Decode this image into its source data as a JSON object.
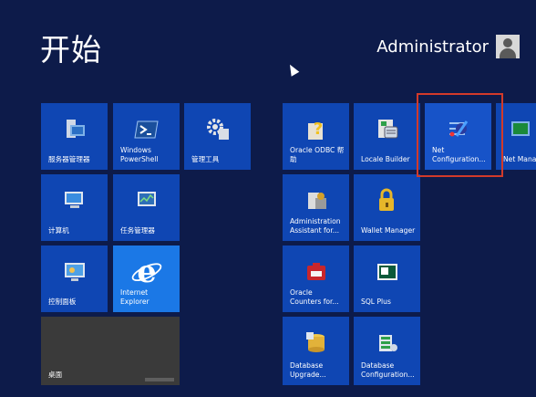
{
  "screen": {
    "title": "开始"
  },
  "user": {
    "name": "Administrator"
  },
  "tiles_left": [
    {
      "label": "服务器管理器",
      "icon": "server-manager-icon"
    },
    {
      "label": "Windows\nPowerShell",
      "icon": "powershell-icon"
    },
    {
      "label": "管理工具",
      "icon": "admin-tools-icon"
    },
    {
      "label": "计算机",
      "icon": "computer-icon"
    },
    {
      "label": "任务管理器",
      "icon": "task-manager-icon"
    },
    {
      "label": "控制面板",
      "icon": "control-panel-icon"
    },
    {
      "label": "Internet\nExplorer",
      "icon": "ie-icon"
    },
    {
      "label": "桌面",
      "icon": "desktop-icon"
    }
  ],
  "tiles_right": [
    {
      "label": "Oracle ODBC 帮\n助",
      "icon": "oracle-odbc-help-icon"
    },
    {
      "label": "Locale Builder",
      "icon": "locale-builder-icon"
    },
    {
      "label": "Net\nConfiguration...",
      "icon": "net-configuration-icon"
    },
    {
      "label": "Net Mana",
      "icon": "net-manager-icon"
    },
    {
      "label": "Administration\nAssistant for...",
      "icon": "admin-assistant-icon"
    },
    {
      "label": "Wallet Manager",
      "icon": "wallet-manager-icon"
    },
    {
      "label": "Oracle\nCounters for...",
      "icon": "oracle-counters-icon"
    },
    {
      "label": "SQL Plus",
      "icon": "sql-plus-icon"
    },
    {
      "label": "Database\nUpgrade...",
      "icon": "database-upgrade-icon"
    },
    {
      "label": "Database\nConfiguration...",
      "icon": "database-configuration-icon"
    }
  ],
  "colors": {
    "background": "#0d1b4a",
    "tile": "#0f46b3",
    "highlight": "#d23a2a"
  }
}
